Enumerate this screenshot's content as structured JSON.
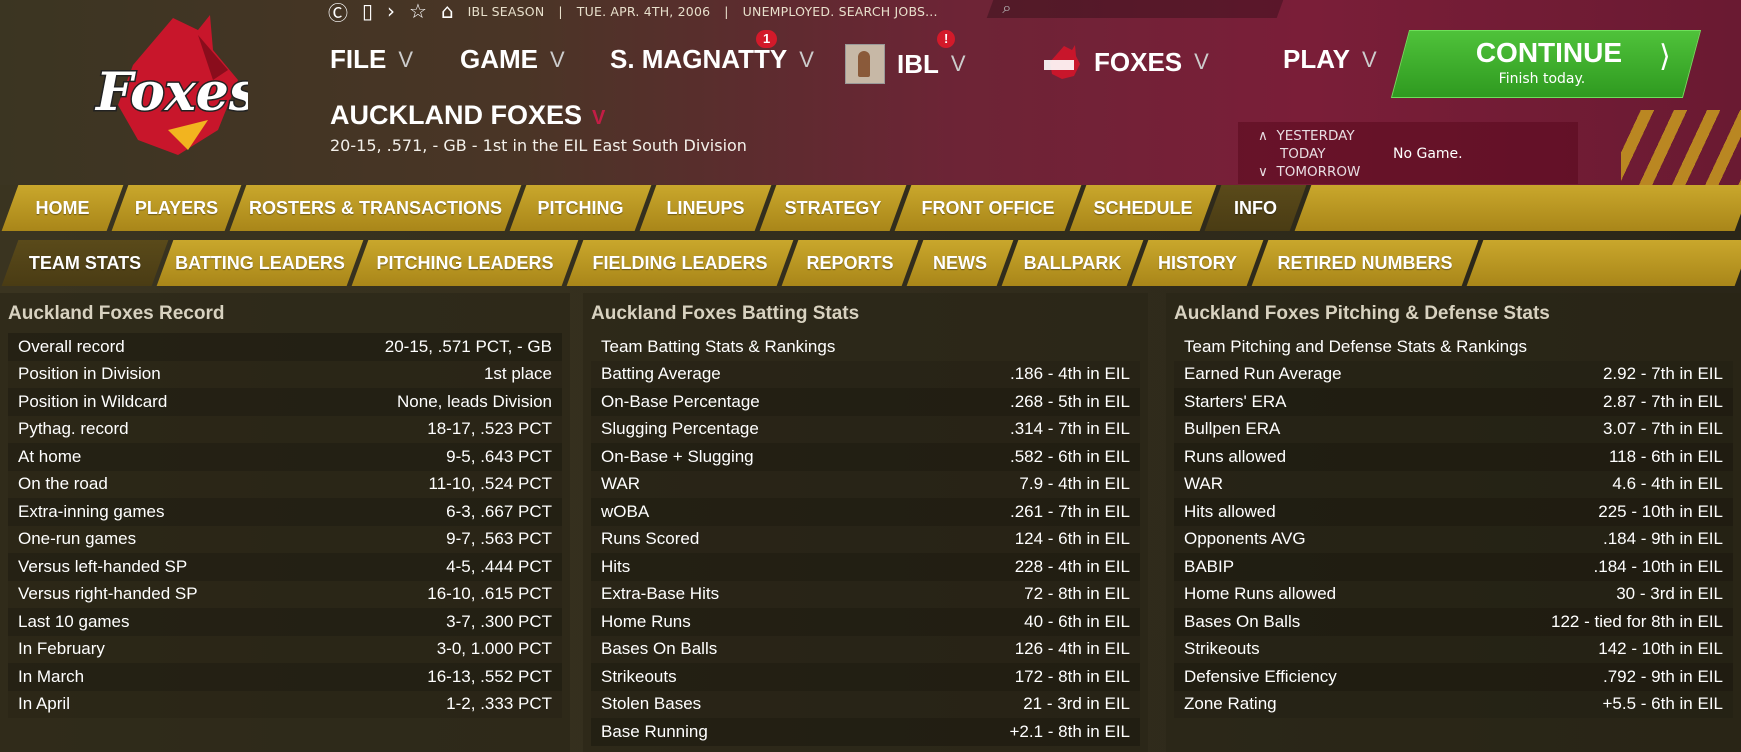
{
  "topbar": {
    "season": "IBL SEASON",
    "date": "TUE. APR. 4TH, 2006",
    "status": "UNEMPLOYED. SEARCH JOBS..."
  },
  "menu": {
    "file": "FILE",
    "game": "GAME",
    "manager": "S. MAGNATTY",
    "manager_badge": "1",
    "league": "IBL",
    "league_badge": "!",
    "team": "FOXES",
    "play": "PLAY"
  },
  "continue": {
    "label": "CONTINUE",
    "sub": "Finish today."
  },
  "team": {
    "name": "AUCKLAND FOXES",
    "record_line": "20-15, .571, - GB - 1st in the EIL East South Division"
  },
  "days": {
    "yesterday": "YESTERDAY",
    "today": "TODAY",
    "tomorrow": "TOMORROW",
    "today_game": "No Game."
  },
  "nav_main": [
    "HOME",
    "PLAYERS",
    "ROSTERS & TRANSACTIONS",
    "PITCHING",
    "LINEUPS",
    "STRATEGY",
    "FRONT OFFICE",
    "SCHEDULE",
    "INFO"
  ],
  "nav_sub": [
    "TEAM STATS",
    "BATTING LEADERS",
    "PITCHING LEADERS",
    "FIELDING LEADERS",
    "REPORTS",
    "NEWS",
    "BALLPARK",
    "HISTORY",
    "RETIRED NUMBERS"
  ],
  "record_panel": {
    "title": "Auckland Foxes Record",
    "rows": [
      {
        "label": "Overall record",
        "value": "20-15, .571 PCT, - GB"
      },
      {
        "label": "Position in Division",
        "value": "1st place"
      },
      {
        "label": "Position in Wildcard",
        "value": "None, leads Division"
      },
      {
        "label": "Pythag. record",
        "value": "18-17, .523 PCT"
      },
      {
        "label": "At home",
        "value": "9-5, .643 PCT"
      },
      {
        "label": "On the road",
        "value": "11-10, .524 PCT"
      },
      {
        "label": "Extra-inning games",
        "value": "6-3, .667 PCT"
      },
      {
        "label": "One-run games",
        "value": "9-7, .563 PCT"
      },
      {
        "label": "Versus left-handed SP",
        "value": "4-5, .444 PCT"
      },
      {
        "label": "Versus right-handed SP",
        "value": "16-10, .615 PCT"
      },
      {
        "label": "Last 10 games",
        "value": "3-7, .300 PCT"
      },
      {
        "label": "In February",
        "value": "3-0, 1.000 PCT"
      },
      {
        "label": "In March",
        "value": "16-13, .552 PCT"
      },
      {
        "label": "In April",
        "value": "1-2, .333 PCT"
      }
    ]
  },
  "batting_panel": {
    "title": "Auckland Foxes Batting Stats",
    "subtitle": "Team Batting Stats & Rankings",
    "rows": [
      {
        "label": "Batting Average",
        "value": ".186 - 4th  in EIL"
      },
      {
        "label": "On-Base Percentage",
        "value": ".268 - 5th  in EIL"
      },
      {
        "label": "Slugging Percentage",
        "value": ".314 - 7th  in EIL"
      },
      {
        "label": "On-Base + Slugging",
        "value": ".582 - 6th  in EIL"
      },
      {
        "label": "WAR",
        "value": "7.9 - 4th  in EIL"
      },
      {
        "label": "wOBA",
        "value": ".261 - 7th  in EIL"
      },
      {
        "label": "Runs Scored",
        "value": "124 - 6th  in EIL"
      },
      {
        "label": "Hits",
        "value": "228 - 4th  in EIL"
      },
      {
        "label": "Extra-Base Hits",
        "value": "72 - 8th  in EIL"
      },
      {
        "label": "Home Runs",
        "value": "40 - 6th  in EIL"
      },
      {
        "label": "Bases On Balls",
        "value": "126 - 4th  in EIL"
      },
      {
        "label": "Strikeouts",
        "value": "172 - 8th  in EIL"
      },
      {
        "label": "Stolen Bases",
        "value": "21 - 3rd  in EIL"
      },
      {
        "label": "Base Running",
        "value": "+2.1 - 8th  in EIL"
      }
    ]
  },
  "pitching_panel": {
    "title": "Auckland Foxes Pitching & Defense Stats",
    "subtitle": "Team Pitching and Defense Stats & Rankings",
    "rows": [
      {
        "label": "Earned Run Average",
        "value": "2.92 - 7th  in EIL"
      },
      {
        "label": "Starters' ERA",
        "value": "2.87 - 7th  in EIL"
      },
      {
        "label": "Bullpen ERA",
        "value": "3.07 - 7th  in EIL"
      },
      {
        "label": "Runs allowed",
        "value": "118 - 6th  in EIL"
      },
      {
        "label": "WAR",
        "value": "4.6 - 4th  in EIL"
      },
      {
        "label": "Hits allowed",
        "value": "225 - 10th  in EIL"
      },
      {
        "label": "Opponents AVG",
        "value": ".184 - 9th  in EIL"
      },
      {
        "label": "BABIP",
        "value": ".184 - 10th  in EIL"
      },
      {
        "label": "Home Runs allowed",
        "value": "30 - 3rd  in EIL"
      },
      {
        "label": "Bases On Balls",
        "value": "122 -  tied for 8th  in EIL"
      },
      {
        "label": "Strikeouts",
        "value": "142 - 10th  in EIL"
      },
      {
        "label": "Defensive Efficiency",
        "value": ".792 - 9th  in EIL"
      },
      {
        "label": "Zone Rating",
        "value": "+5.5 - 6th  in EIL"
      }
    ]
  }
}
